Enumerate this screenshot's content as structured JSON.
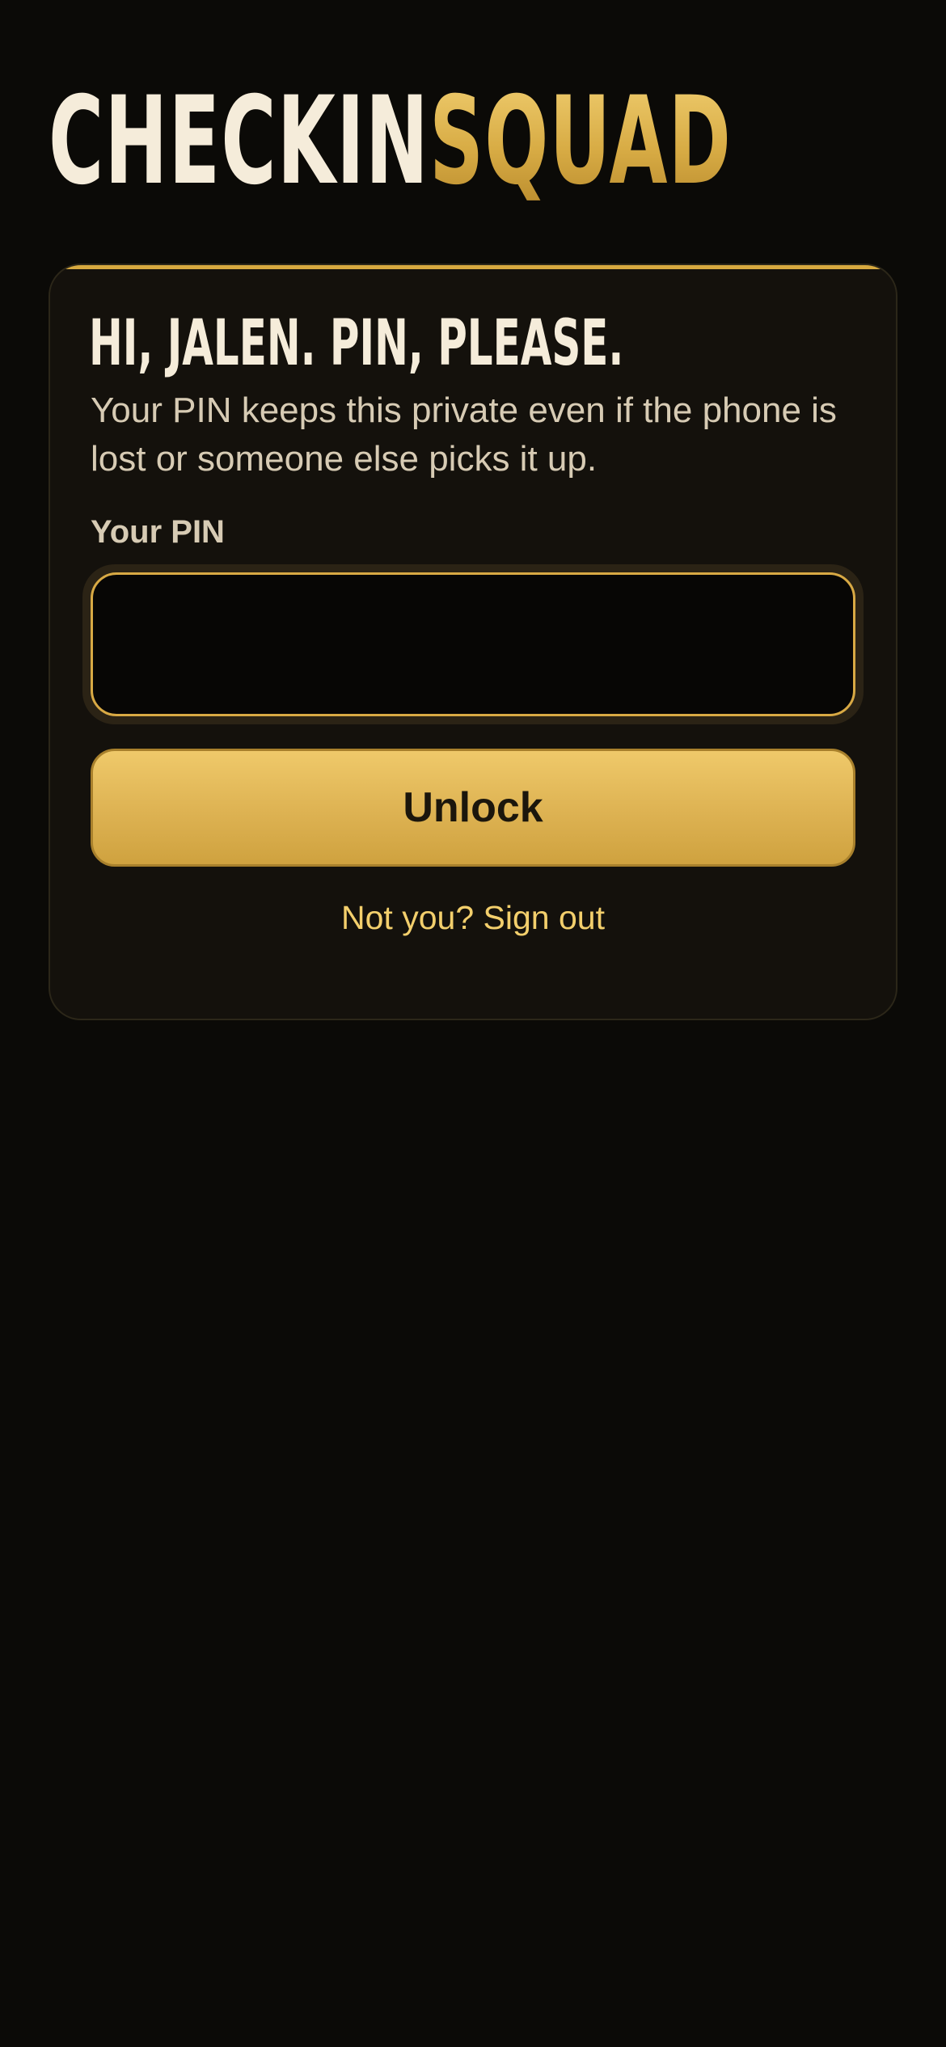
{
  "brand": {
    "part1": "CHECKIN",
    "part2": "SQUAD"
  },
  "card": {
    "title": "HI, JALEN. PIN, PLEASE.",
    "subtitle": "Your PIN keeps this private even if the phone is lost or someone else picks it up.",
    "pin_label": "Your PIN",
    "pin_value": "",
    "unlock_label": "Unlock",
    "signout_label": "Not you? Sign out"
  },
  "colors": {
    "background": "#0b0a07",
    "card": "#14110c",
    "accent": "#d7a93f",
    "text_primary": "#f5ecda",
    "text_secondary": "#d7cbb4",
    "link": "#f3cf6c"
  }
}
